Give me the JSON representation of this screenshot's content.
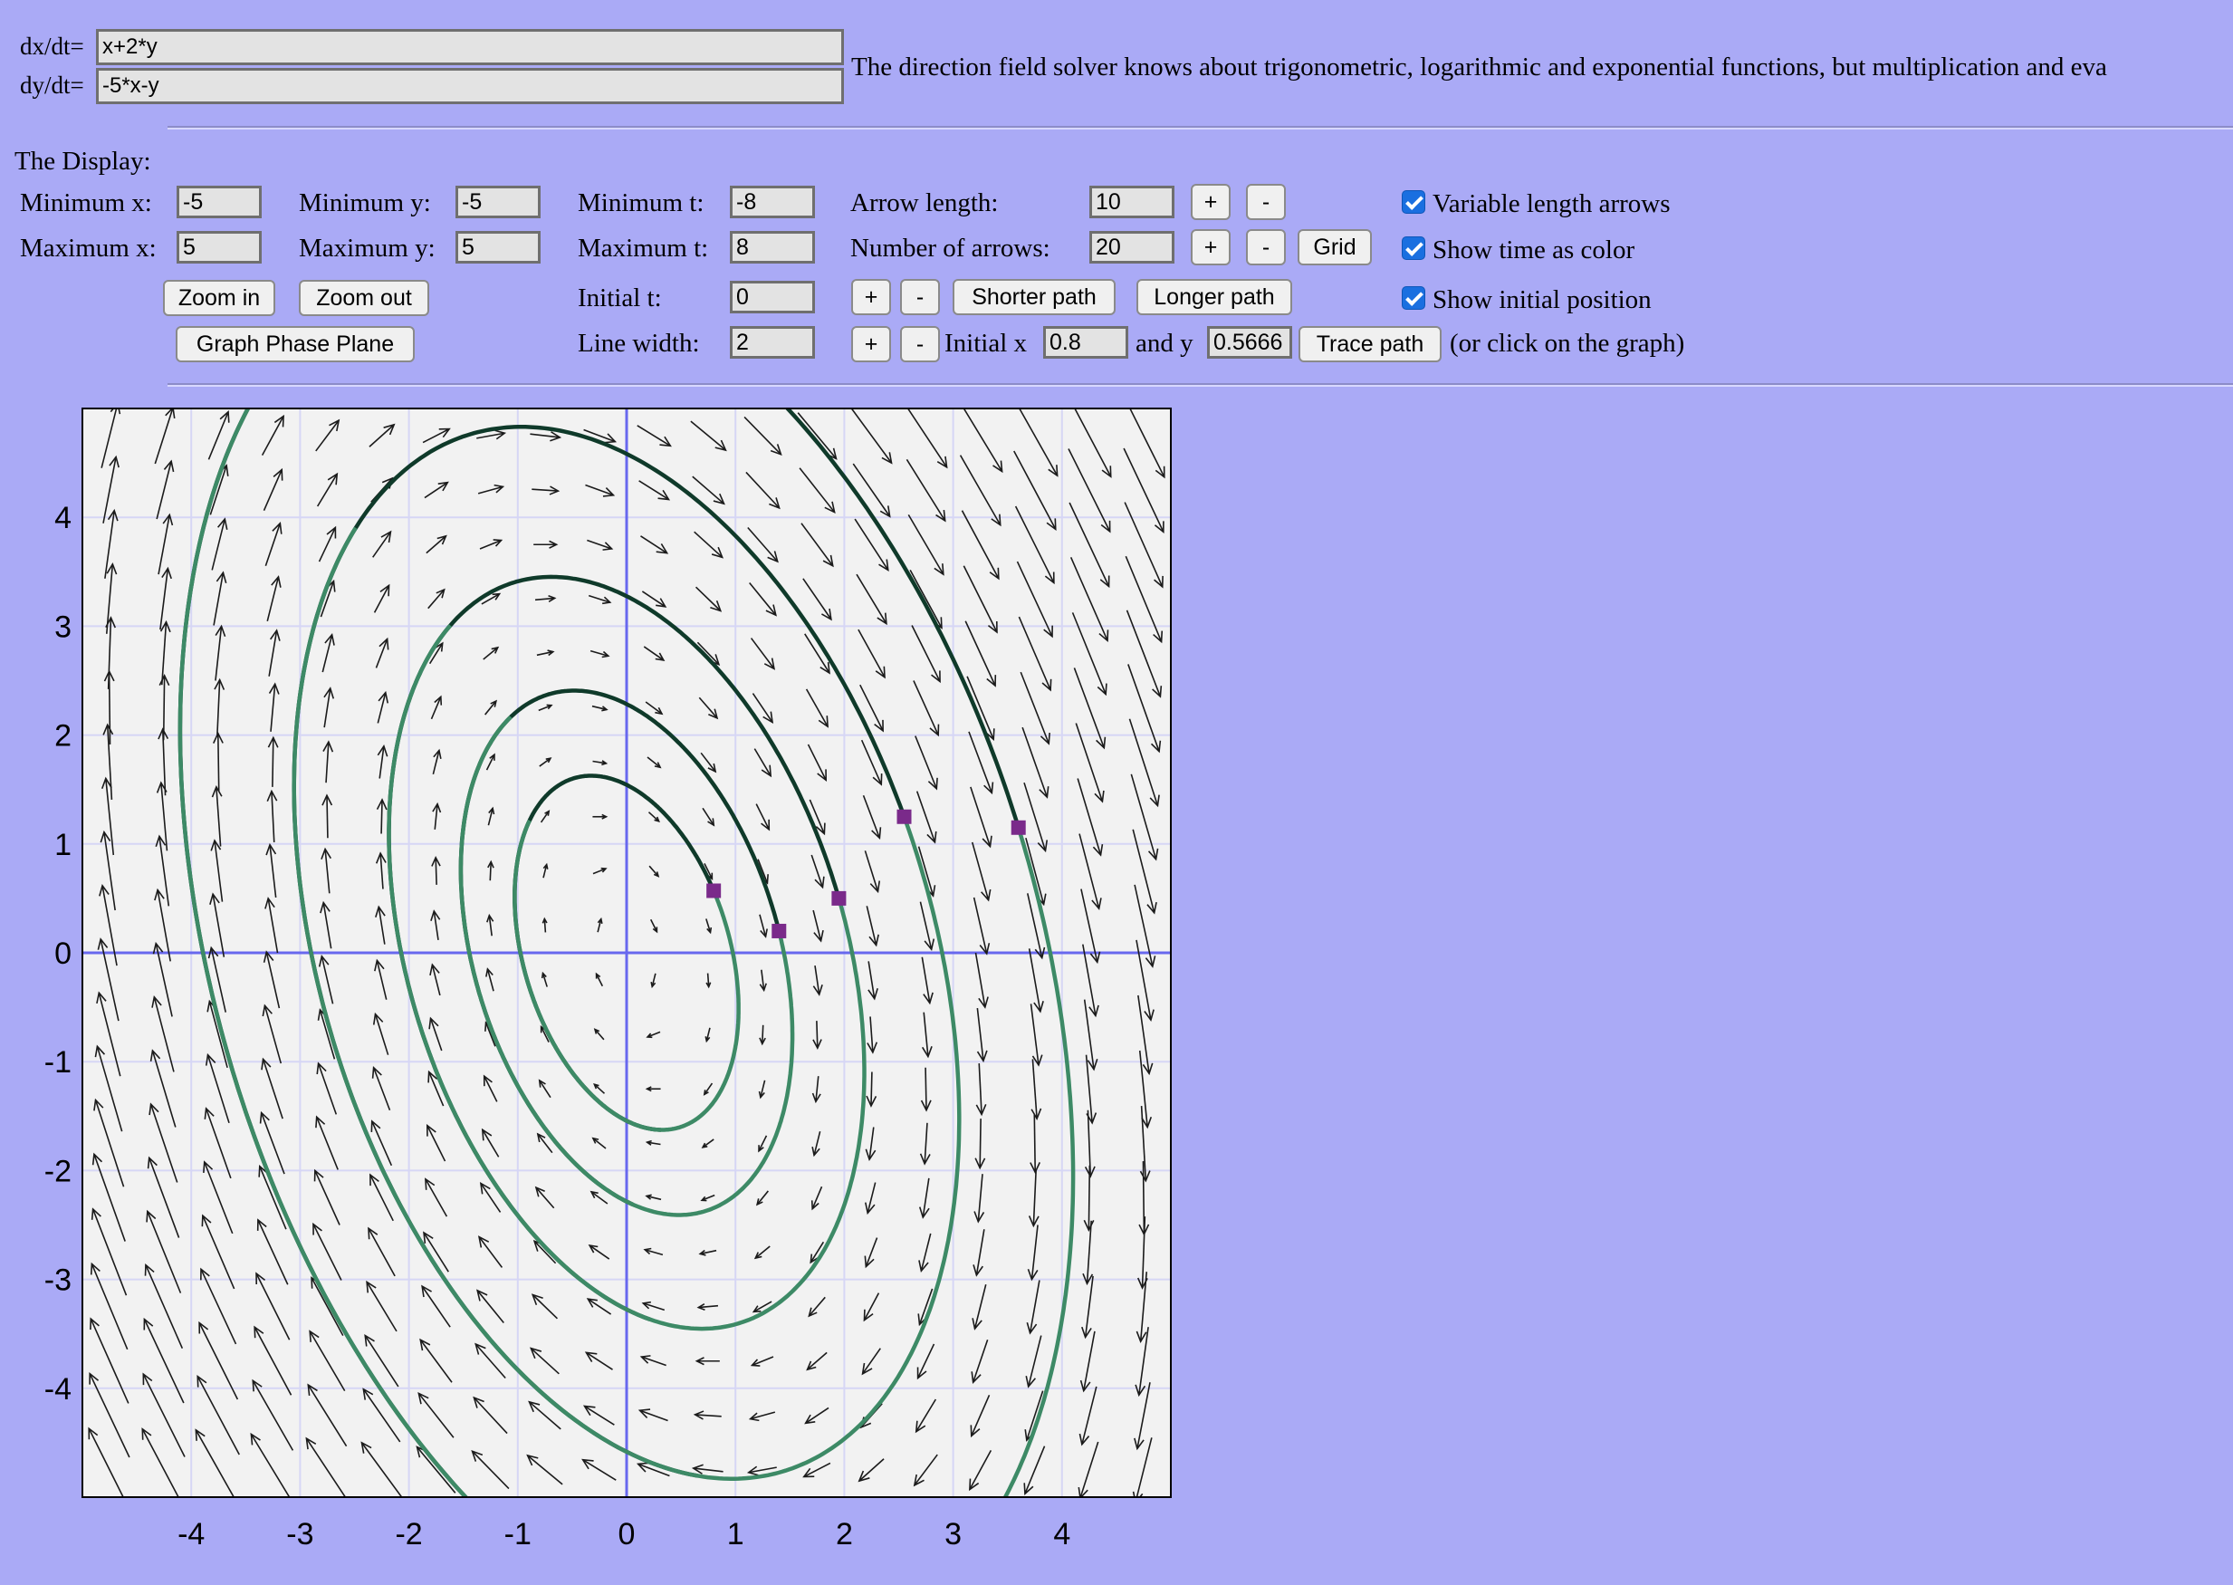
{
  "equations": {
    "dx_label": "dx/dt=",
    "dx_value": "x+2*y",
    "dy_label": "dy/dt=",
    "dy_value": "-5*x-y",
    "note": "The direction field solver knows about trigonometric, logarithmic and exponential functions, but multiplication and eva"
  },
  "display": {
    "heading": "The Display:",
    "min_x_label": "Minimum x:",
    "min_x": "-5",
    "max_x_label": "Maximum x:",
    "max_x": "5",
    "min_y_label": "Minimum y:",
    "min_y": "-5",
    "max_y_label": "Maximum y:",
    "max_y": "5",
    "min_t_label": "Minimum t:",
    "min_t": "-8",
    "max_t_label": "Maximum t:",
    "max_t": "8",
    "initial_t_label": "Initial t:",
    "initial_t": "0",
    "line_width_label": "Line width:",
    "line_width": "2",
    "arrow_length_label": "Arrow length:",
    "arrow_length": "10",
    "num_arrows_label": "Number of arrows:",
    "num_arrows": "20",
    "initial_x_label": "Initial x",
    "initial_x": "0.8",
    "and_y_label": "and y",
    "initial_y": "0.5666",
    "click_hint": "(or click on the graph)"
  },
  "buttons": {
    "zoom_in": "Zoom in",
    "zoom_out": "Zoom out",
    "graph_phase_plane": "Graph Phase Plane",
    "plus": "+",
    "minus": "-",
    "grid": "Grid",
    "shorter_path": "Shorter path",
    "longer_path": "Longer path",
    "trace_path": "Trace path"
  },
  "options": {
    "variable_length": "Variable length arrows",
    "show_time_color": "Show time as color",
    "show_initial_position": "Show initial position"
  },
  "graph": {
    "xmin": -5,
    "xmax": 5,
    "ymin": -5,
    "ymax": 5,
    "x_ticks": [
      "-4",
      "-3",
      "-2",
      "-1",
      "0",
      "1",
      "2",
      "3",
      "4"
    ],
    "y_ticks": [
      "4",
      "3",
      "2",
      "1",
      "0",
      "-1",
      "-2",
      "-3",
      "-4"
    ],
    "arrows_per_side": 20,
    "initial_points": [
      [
        0.8,
        0.57
      ],
      [
        1.4,
        0.2
      ],
      [
        1.95,
        0.5
      ],
      [
        2.55,
        1.25
      ],
      [
        3.6,
        1.15
      ]
    ],
    "colors": {
      "background": "#f2f2f2",
      "grid": "#d6d6f5",
      "axes": "#6868ee",
      "arrow": "#1b1b1b",
      "path_green": "#3d8a66",
      "path_dark": "#0f3a2a",
      "marker": "#7a2a8a"
    }
  }
}
